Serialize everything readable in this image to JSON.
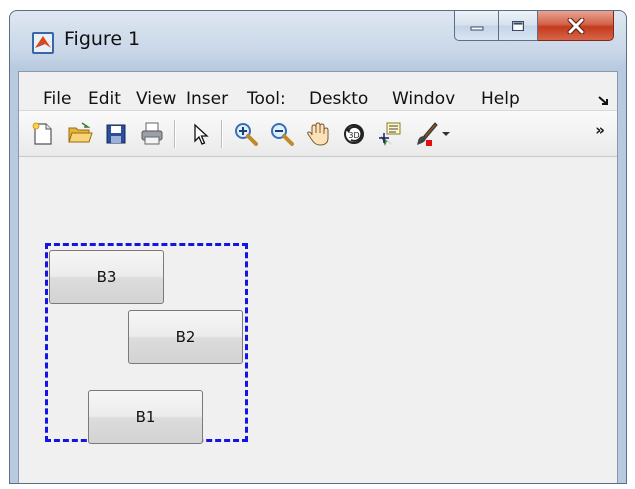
{
  "window": {
    "title": "Figure 1",
    "min_icon": "minimize-icon",
    "max_icon": "maximize-icon",
    "close_icon": "close-icon",
    "close_color": "#c43a1c"
  },
  "menubar": {
    "items": [
      "File",
      "Edit",
      "View",
      "Inser",
      "Tool:",
      "Deskto",
      "Windov",
      "Help"
    ],
    "overflow_icon": "menu-overflow-icon"
  },
  "toolbar": {
    "tools": [
      "new-figure-icon",
      "open-file-icon",
      "save-icon",
      "print-icon",
      "edit-plot-icon",
      "zoom-in-icon",
      "zoom-out-icon",
      "pan-icon",
      "rotate-3d-icon",
      "data-cursor-icon",
      "brush-icon",
      "brush-dropdown-icon"
    ],
    "overflow_label": "»"
  },
  "figure": {
    "group_border_color": "#1414e6",
    "buttons": {
      "b3": "B3",
      "b2": "B2",
      "b1": "B1"
    }
  }
}
